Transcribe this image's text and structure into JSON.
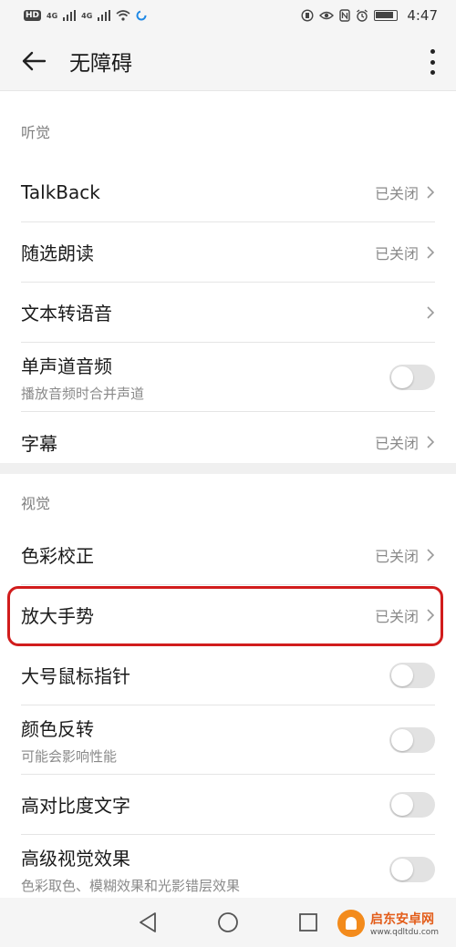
{
  "status_bar": {
    "badge": "HD",
    "signal1": "4G",
    "signal2": "4G",
    "time": "4:47"
  },
  "app_bar": {
    "title": "无障碍"
  },
  "hearing": {
    "header": "听觉",
    "items": [
      {
        "title": "TalkBack",
        "value": "已关闭"
      },
      {
        "title": "随选朗读",
        "value": "已关闭"
      },
      {
        "title": "文本转语音"
      },
      {
        "title": "单声道音频",
        "subtitle": "播放音频时合并声道",
        "toggle": "off"
      },
      {
        "title": "字幕",
        "value": "已关闭"
      }
    ]
  },
  "vision": {
    "header": "视觉",
    "items": [
      {
        "title": "色彩校正",
        "value": "已关闭"
      },
      {
        "title": "放大手势",
        "value": "已关闭"
      },
      {
        "title": "大号鼠标指针",
        "toggle": "off"
      },
      {
        "title": "颜色反转",
        "subtitle": "可能会影响性能",
        "toggle": "off"
      },
      {
        "title": "高对比度文字",
        "toggle": "off"
      },
      {
        "title": "高级视觉效果",
        "subtitle": "色彩取色、模糊效果和光影错层效果",
        "toggle": "off"
      }
    ]
  },
  "watermark": {
    "name": "启东安卓网",
    "url": "www.qdltdu.com"
  },
  "colors": {
    "highlight": "#d11c1c",
    "toggle_off": "#e2e2e2",
    "secondary_text": "#8a8a8a"
  }
}
